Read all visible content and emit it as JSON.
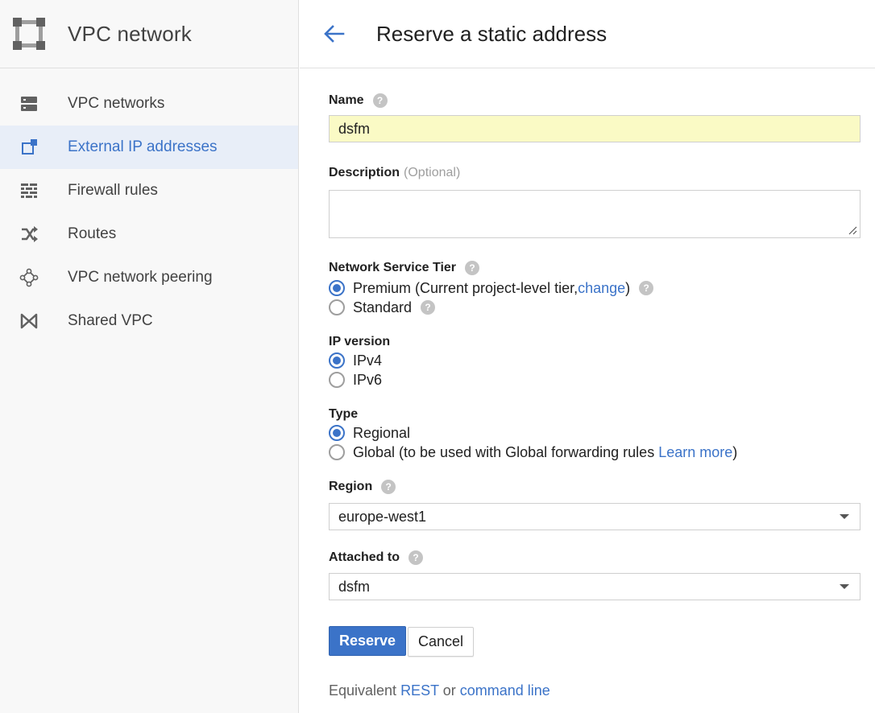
{
  "sidebar": {
    "product_title": "VPC network",
    "items": [
      {
        "label": "VPC networks",
        "icon": "vpc-networks-icon",
        "active": false
      },
      {
        "label": "External IP addresses",
        "icon": "external-ip-icon",
        "active": true
      },
      {
        "label": "Firewall rules",
        "icon": "firewall-icon",
        "active": false
      },
      {
        "label": "Routes",
        "icon": "routes-icon",
        "active": false
      },
      {
        "label": "VPC network peering",
        "icon": "peering-icon",
        "active": false
      },
      {
        "label": "Shared VPC",
        "icon": "shared-vpc-icon",
        "active": false
      }
    ]
  },
  "header": {
    "title": "Reserve a static address"
  },
  "form": {
    "name": {
      "label": "Name",
      "value": "dsfm"
    },
    "description": {
      "label": "Description",
      "optional": "(Optional)",
      "value": ""
    },
    "tier": {
      "label": "Network Service Tier",
      "premium_label": "Premium (Current project-level tier, ",
      "premium_link": "change",
      "premium_suffix": ")",
      "standard_label": "Standard",
      "selected": "premium"
    },
    "ip_version": {
      "label": "IP version",
      "options": [
        "IPv4",
        "IPv6"
      ],
      "selected": "IPv4"
    },
    "type": {
      "label": "Type",
      "regional_label": "Regional",
      "global_label": "Global (to be used with Global forwarding rules ",
      "global_link": "Learn more",
      "global_suffix": ")",
      "selected": "regional"
    },
    "region": {
      "label": "Region",
      "value": "europe-west1"
    },
    "attached_to": {
      "label": "Attached to",
      "value": "dsfm"
    }
  },
  "actions": {
    "reserve": "Reserve",
    "cancel": "Cancel"
  },
  "footer": {
    "equivalent": "Equivalent ",
    "rest": "REST",
    "or": " or ",
    "command_line": "command line"
  },
  "colors": {
    "accent": "#3b73c8",
    "sidebar_bg": "#f8f8f8",
    "active_item_bg": "#e8eef8",
    "name_field_bg": "#fafac5"
  }
}
